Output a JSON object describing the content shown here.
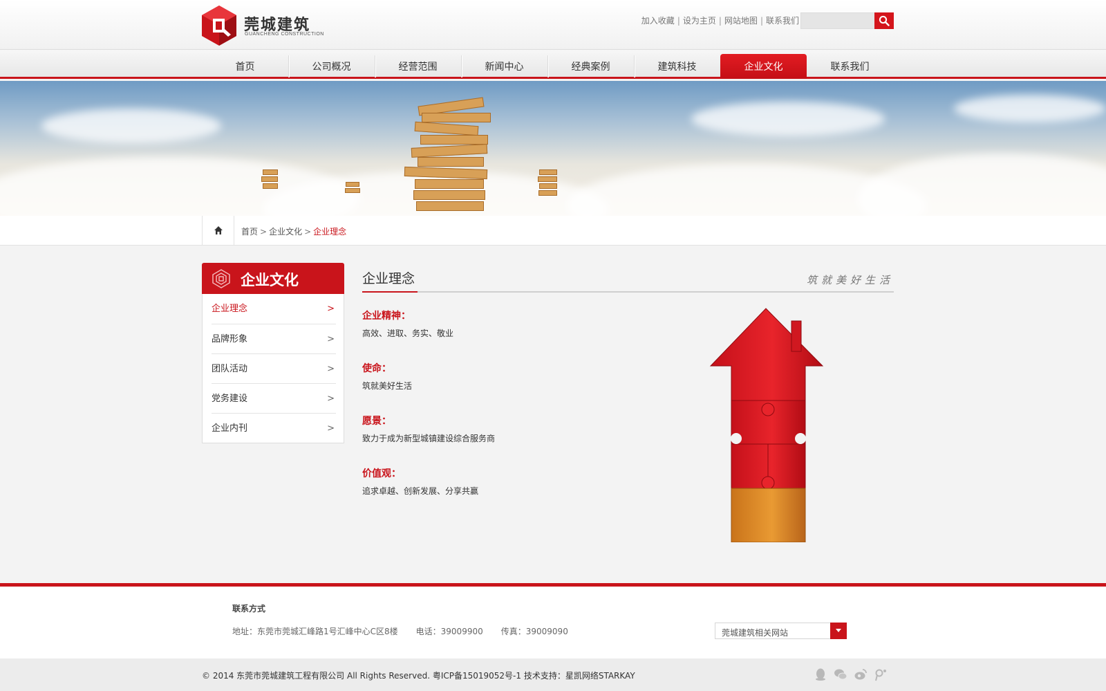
{
  "brand": {
    "name_cn": "莞城建筑",
    "name_en": "GUANCHENG CONSTRUCTION",
    "accent": "#c9141b"
  },
  "top_links": [
    "加入收藏",
    "设为主页",
    "网站地图",
    "联系我们"
  ],
  "search": {
    "placeholder": ""
  },
  "nav": {
    "items": [
      "首页",
      "公司概况",
      "经营范围",
      "新闻中心",
      "经典案例",
      "建筑科技",
      "企业文化",
      "联系我们"
    ],
    "active": "企业文化"
  },
  "breadcrumb": {
    "home": "首页",
    "section": "企业文化",
    "current": "企业理念",
    "separator": ">"
  },
  "sidebar": {
    "title": "企业文化",
    "items": [
      "企业理念",
      "品牌形象",
      "团队活动",
      "党务建设",
      "企业内刊"
    ],
    "active": "企业理念",
    "chevron": ">"
  },
  "content": {
    "title": "企业理念",
    "slogan": "筑就美好生活",
    "sections": [
      {
        "heading": "企业精神：",
        "text": "高效、进取、务实、敬业"
      },
      {
        "heading": "使命：",
        "text": "筑就美好生活"
      },
      {
        "heading": "愿景：",
        "text": "致力于成为新型城镇建设综合服务商"
      },
      {
        "heading": "价值观：",
        "text": "追求卓越、创新发展、分享共赢"
      }
    ]
  },
  "footer": {
    "contact_heading": "联系方式",
    "address": "地址：东莞市莞城汇峰路1号汇峰中心C区8楼",
    "phone": "电话：39009900",
    "fax": "传真：39009090",
    "related_select": "莞城建筑相关网站",
    "copyright": "© 2014 东莞市莞城建筑工程有限公司 All Rights Reserved. 粤ICP备15019052号-1  技术支持：星凯网络STARKAY"
  },
  "social_icons": [
    "qq-icon",
    "wechat-icon",
    "weibo-icon",
    "tencent-weibo-icon"
  ]
}
